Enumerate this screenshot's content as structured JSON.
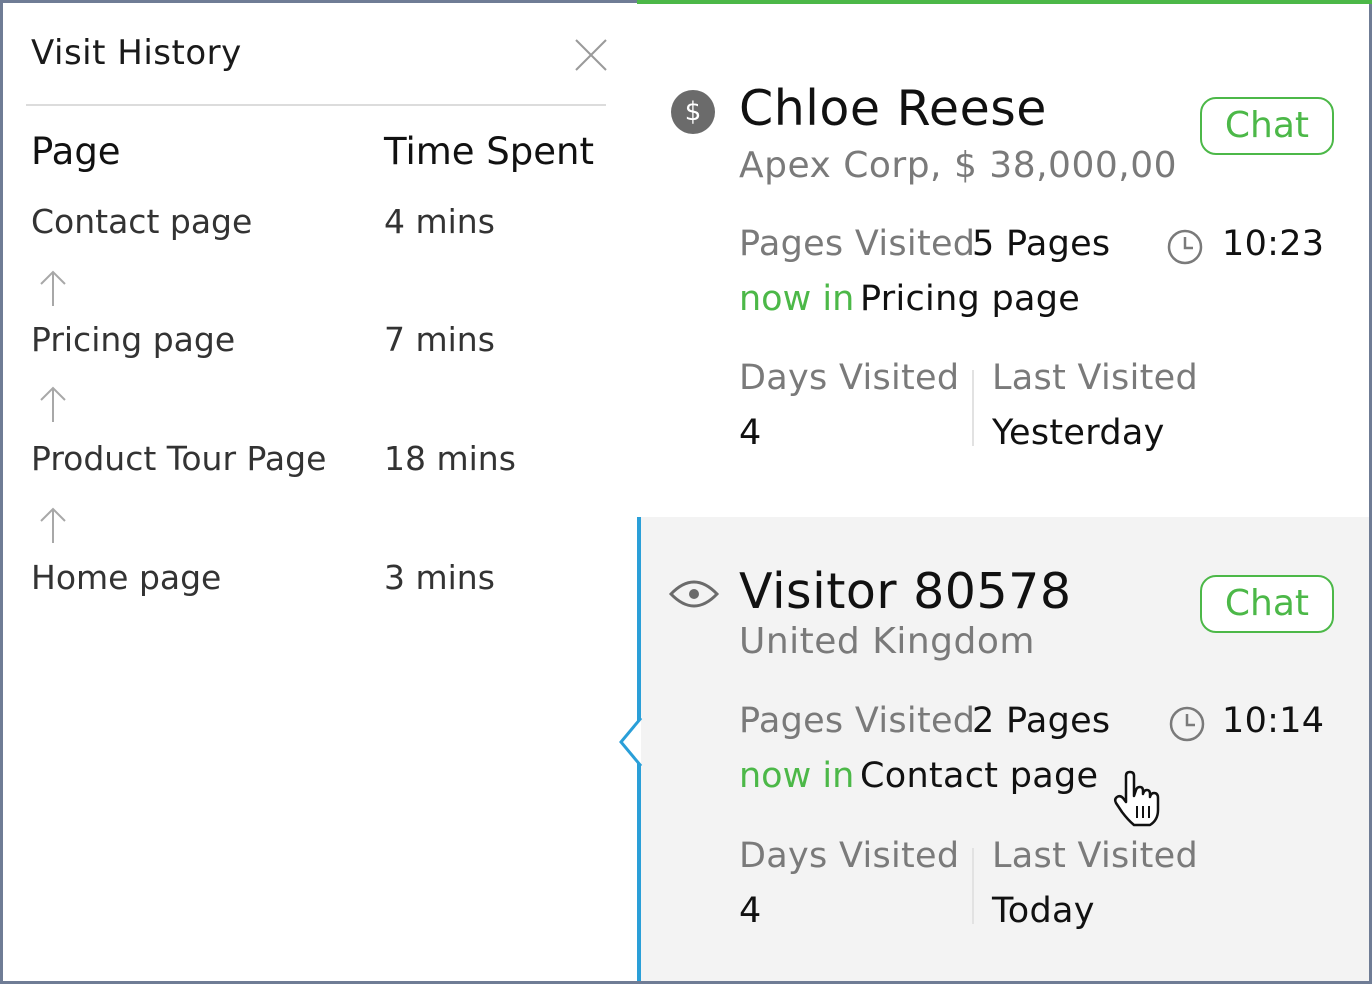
{
  "visit_history": {
    "title": "Visit History",
    "columns": {
      "page": "Page",
      "time_spent": "Time Spent"
    },
    "rows": [
      {
        "page": "Contact page",
        "time": "4 mins"
      },
      {
        "page": "Pricing page",
        "time": "7 mins"
      },
      {
        "page": "Product Tour Page",
        "time": "18 mins"
      },
      {
        "page": "Home page",
        "time": "3 mins"
      }
    ]
  },
  "visitors": [
    {
      "icon": "dollar-icon",
      "name": "Chloe Reese",
      "subtitle": "Apex Corp, $ 38,000,00",
      "chat_label": "Chat",
      "pages_visited_label": "Pages Visited",
      "pages_visited_value": "5 Pages",
      "time": "10:23",
      "now_in_label": "now in",
      "now_in_page": "Pricing page",
      "days_visited_label": "Days Visited",
      "days_visited_value": "4",
      "last_visited_label": "Last Visited",
      "last_visited_value": "Yesterday",
      "accent": "#4cb848"
    },
    {
      "icon": "eye-icon",
      "name": "Visitor 80578",
      "subtitle": "United Kingdom",
      "chat_label": "Chat",
      "pages_visited_label": "Pages Visited",
      "pages_visited_value": "2 Pages",
      "time": "10:14",
      "now_in_label": "now in",
      "now_in_page": "Contact page",
      "days_visited_label": "Days Visited",
      "days_visited_value": "4",
      "last_visited_label": "Last Visited",
      "last_visited_value": "Today",
      "accent": "#2a9fd8"
    }
  ],
  "colors": {
    "green": "#4cb848",
    "blue": "#2a9fd8",
    "frame": "#6f7c95",
    "muted_text": "#7a7a7a",
    "selected_bg": "#f3f3f3"
  }
}
